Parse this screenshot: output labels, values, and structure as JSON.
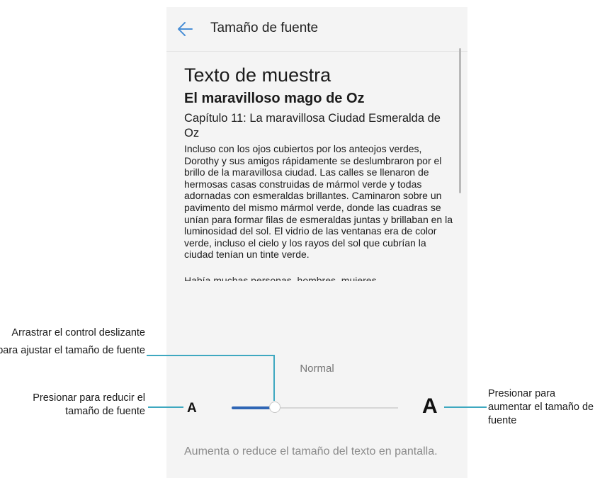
{
  "header": {
    "title": "Tamaño de fuente",
    "back_icon": "arrow-left-icon",
    "accent_color": "#4a8fd6"
  },
  "preview": {
    "heading": "Texto de muestra",
    "book_title": "El maravilloso mago de Oz",
    "chapter": "Capítulo 11: La maravillosa Ciudad Esmeralda de Oz",
    "paragraph": "Incluso con los ojos cubiertos por los anteojos verdes, Dorothy y sus amigos rápidamente se deslumbraron por el brillo de la maravillosa ciudad. Las calles se llenaron de hermosas casas construidas de mármol verde y todas adornadas con esmeraldas brillantes. Caminaron sobre un pavimento del mismo mármol verde, donde las cuadras se unían para formar filas de esmeraldas juntas y brillaban en la luminosidad del sol. El vidrio de las ventanas era de color verde, incluso el cielo y los rayos del sol que cubrían la ciudad tenían un tinte verde.",
    "paragraph_cut": "Había muchas personas, hombres, mujeres"
  },
  "font_size": {
    "current_label": "Normal",
    "small_label": "A",
    "large_label": "A",
    "slider_level_fraction": 0.25,
    "track_fill_color": "#2f66b5",
    "description": "Aumenta o reduce el tamaño del texto en pantalla."
  },
  "annotations": {
    "drag": "Arrastrar el control deslizante para ajustar el tamaño de fuente",
    "reduce": "Presionar para reducir el tamaño de fuente",
    "increase": "Presionar para aumentar el tamaño de fuente",
    "line_color": "#3ea8c0"
  }
}
